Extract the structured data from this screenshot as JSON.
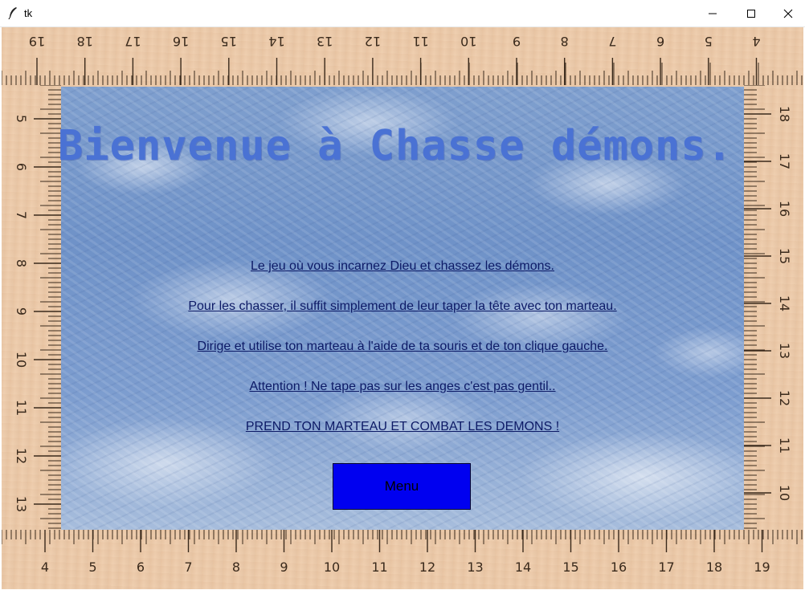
{
  "window": {
    "title": "tk",
    "app_icon": "feather-icon",
    "controls": {
      "minimize": "minimize-icon",
      "maximize": "maximize-icon",
      "close": "close-icon"
    }
  },
  "rulers": {
    "top_numbers": [
      "19",
      "18",
      "17",
      "16",
      "15",
      "14",
      "13",
      "12",
      "11",
      "10",
      "9",
      "8",
      "7",
      "6",
      "5",
      "4"
    ],
    "bottom_numbers": [
      "4",
      "5",
      "6",
      "7",
      "8",
      "9",
      "10",
      "11",
      "12",
      "13",
      "14",
      "15",
      "16",
      "17",
      "18",
      "19"
    ],
    "left_numbers": [
      "5",
      "6",
      "7",
      "8",
      "9",
      "10",
      "11",
      "12",
      "13"
    ],
    "right_numbers": [
      "18",
      "17",
      "16",
      "15",
      "14",
      "13",
      "12",
      "11",
      "10"
    ]
  },
  "content": {
    "title": "Bienvenue à Chasse démons.",
    "lines": [
      "Le jeu où vous incarnez Dieu et chassez les démons.",
      "Pour les chasser, il suffit simplement de leur taper la tête avec ton marteau.",
      "Dirige et utilise ton marteau à l'aide de ta souris et de ton clique gauche.",
      "Attention ! Ne tape pas sur les anges c'est pas gentil..",
      "PREND TON MARTEAU ET COMBAT LES DEMONS !"
    ],
    "menu_button": "Menu"
  },
  "colors": {
    "title": "#4a72d4",
    "text": "#0d1a66",
    "button": "#0000f0",
    "ruler_wood": "#eccaaa"
  }
}
